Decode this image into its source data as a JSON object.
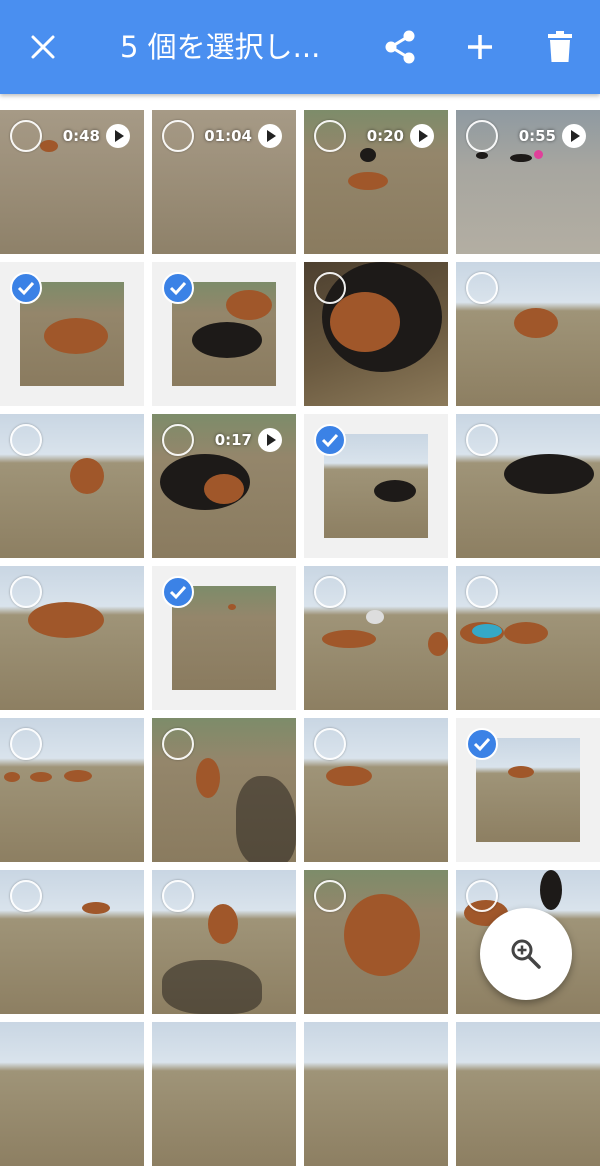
{
  "appbar": {
    "title": "5 個を選択し...",
    "icons": {
      "close": "close-icon",
      "share": "share-icon",
      "add": "add-icon",
      "delete": "delete-icon"
    },
    "color": "#4a8ff0"
  },
  "grid": {
    "selected_count": 5,
    "video_durations": [
      "0:48",
      "01:04",
      "0:20",
      "0:55",
      "0:17"
    ]
  },
  "fab": {
    "icon": "zoom-in-icon"
  },
  "colors": {
    "accent": "#3b82e6",
    "selected_bg": "#f1f1f1"
  }
}
